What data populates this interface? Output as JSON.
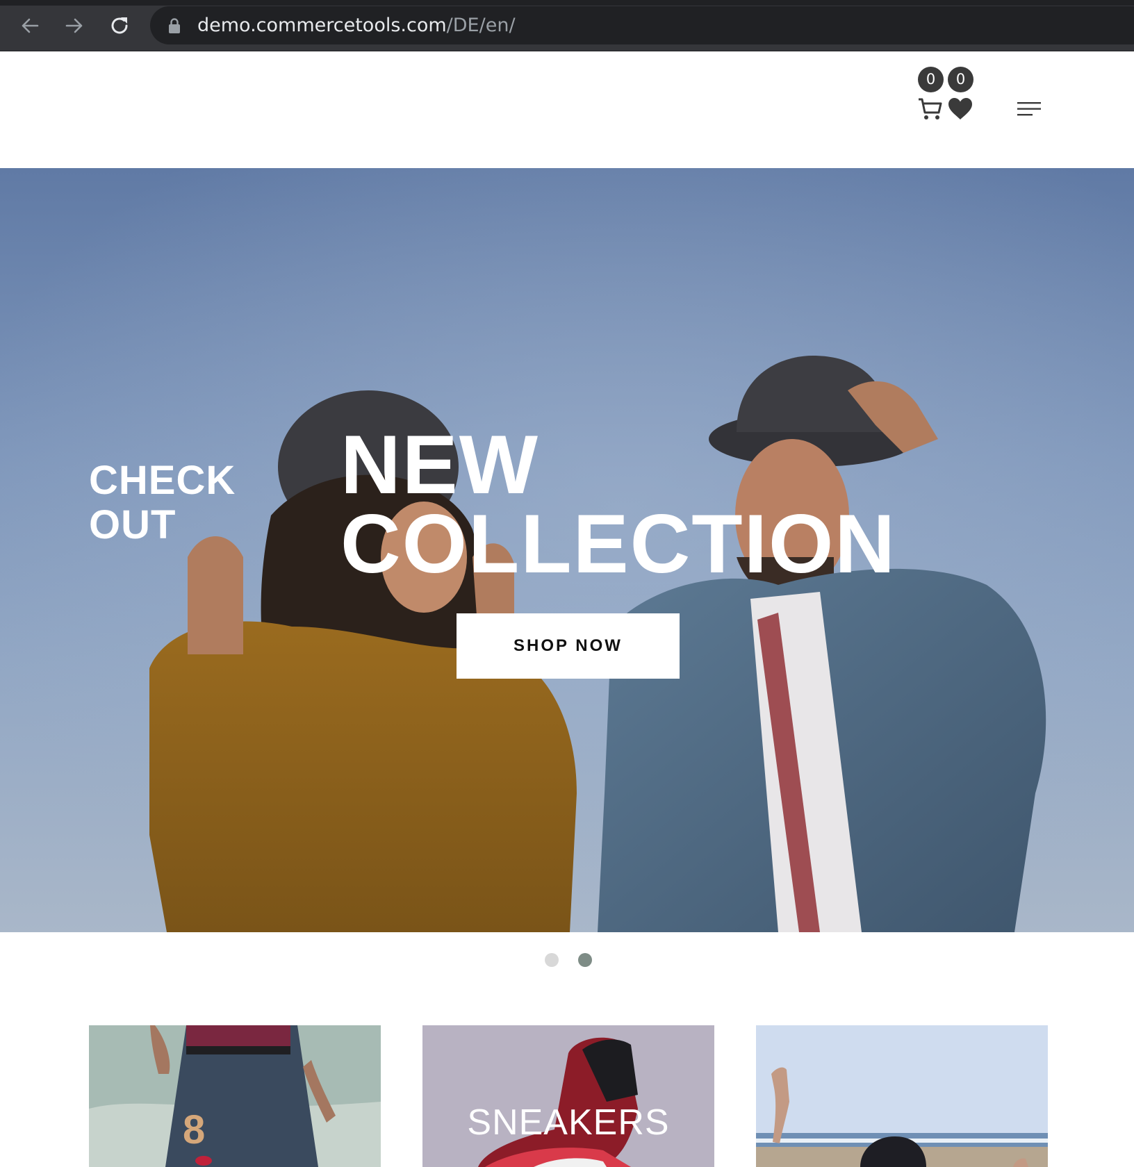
{
  "browser": {
    "url_host": "demo.commercetools.com",
    "url_path": "/DE/en/",
    "icons": [
      "back-arrow-icon",
      "forward-arrow-icon",
      "reload-icon",
      "lock-icon"
    ]
  },
  "header": {
    "cart_count": "0",
    "wishlist_count": "0",
    "icons": [
      "cart-icon",
      "heart-icon",
      "hamburger-menu-icon"
    ],
    "colors": {
      "badge": "#3a3a3a",
      "icon": "#3a3a3a"
    }
  },
  "hero": {
    "kicker_line1": "CHECK",
    "kicker_line2": "OUT",
    "title_line1": "NEW",
    "title_line2": "COLLECTION",
    "cta_label": "SHOP NOW",
    "colors": {
      "sky": "#7f97bb",
      "text": "#ffffff"
    }
  },
  "carousel": {
    "slide_count": 2,
    "active_slide": 2,
    "colors": {
      "dot": "#d8d8d8",
      "dot_active": "#7e8c86"
    }
  },
  "categories": {
    "tiles": [
      {
        "label": ""
      },
      {
        "label": "SNEAKERS"
      },
      {
        "label": ""
      }
    ]
  }
}
